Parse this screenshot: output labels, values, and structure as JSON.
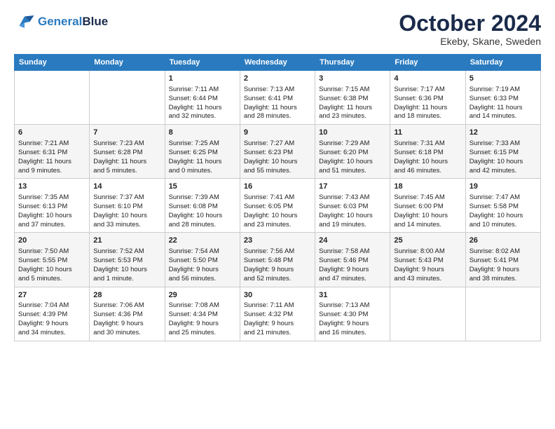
{
  "header": {
    "logo_line1": "General",
    "logo_line2": "Blue",
    "month_title": "October 2024",
    "location": "Ekeby, Skane, Sweden"
  },
  "weekdays": [
    "Sunday",
    "Monday",
    "Tuesday",
    "Wednesday",
    "Thursday",
    "Friday",
    "Saturday"
  ],
  "weeks": [
    [
      {
        "day": "",
        "info": ""
      },
      {
        "day": "",
        "info": ""
      },
      {
        "day": "1",
        "info": "Sunrise: 7:11 AM\nSunset: 6:44 PM\nDaylight: 11 hours\nand 32 minutes."
      },
      {
        "day": "2",
        "info": "Sunrise: 7:13 AM\nSunset: 6:41 PM\nDaylight: 11 hours\nand 28 minutes."
      },
      {
        "day": "3",
        "info": "Sunrise: 7:15 AM\nSunset: 6:38 PM\nDaylight: 11 hours\nand 23 minutes."
      },
      {
        "day": "4",
        "info": "Sunrise: 7:17 AM\nSunset: 6:36 PM\nDaylight: 11 hours\nand 18 minutes."
      },
      {
        "day": "5",
        "info": "Sunrise: 7:19 AM\nSunset: 6:33 PM\nDaylight: 11 hours\nand 14 minutes."
      }
    ],
    [
      {
        "day": "6",
        "info": "Sunrise: 7:21 AM\nSunset: 6:31 PM\nDaylight: 11 hours\nand 9 minutes."
      },
      {
        "day": "7",
        "info": "Sunrise: 7:23 AM\nSunset: 6:28 PM\nDaylight: 11 hours\nand 5 minutes."
      },
      {
        "day": "8",
        "info": "Sunrise: 7:25 AM\nSunset: 6:25 PM\nDaylight: 11 hours\nand 0 minutes."
      },
      {
        "day": "9",
        "info": "Sunrise: 7:27 AM\nSunset: 6:23 PM\nDaylight: 10 hours\nand 55 minutes."
      },
      {
        "day": "10",
        "info": "Sunrise: 7:29 AM\nSunset: 6:20 PM\nDaylight: 10 hours\nand 51 minutes."
      },
      {
        "day": "11",
        "info": "Sunrise: 7:31 AM\nSunset: 6:18 PM\nDaylight: 10 hours\nand 46 minutes."
      },
      {
        "day": "12",
        "info": "Sunrise: 7:33 AM\nSunset: 6:15 PM\nDaylight: 10 hours\nand 42 minutes."
      }
    ],
    [
      {
        "day": "13",
        "info": "Sunrise: 7:35 AM\nSunset: 6:13 PM\nDaylight: 10 hours\nand 37 minutes."
      },
      {
        "day": "14",
        "info": "Sunrise: 7:37 AM\nSunset: 6:10 PM\nDaylight: 10 hours\nand 33 minutes."
      },
      {
        "day": "15",
        "info": "Sunrise: 7:39 AM\nSunset: 6:08 PM\nDaylight: 10 hours\nand 28 minutes."
      },
      {
        "day": "16",
        "info": "Sunrise: 7:41 AM\nSunset: 6:05 PM\nDaylight: 10 hours\nand 23 minutes."
      },
      {
        "day": "17",
        "info": "Sunrise: 7:43 AM\nSunset: 6:03 PM\nDaylight: 10 hours\nand 19 minutes."
      },
      {
        "day": "18",
        "info": "Sunrise: 7:45 AM\nSunset: 6:00 PM\nDaylight: 10 hours\nand 14 minutes."
      },
      {
        "day": "19",
        "info": "Sunrise: 7:47 AM\nSunset: 5:58 PM\nDaylight: 10 hours\nand 10 minutes."
      }
    ],
    [
      {
        "day": "20",
        "info": "Sunrise: 7:50 AM\nSunset: 5:55 PM\nDaylight: 10 hours\nand 5 minutes."
      },
      {
        "day": "21",
        "info": "Sunrise: 7:52 AM\nSunset: 5:53 PM\nDaylight: 10 hours\nand 1 minute."
      },
      {
        "day": "22",
        "info": "Sunrise: 7:54 AM\nSunset: 5:50 PM\nDaylight: 9 hours\nand 56 minutes."
      },
      {
        "day": "23",
        "info": "Sunrise: 7:56 AM\nSunset: 5:48 PM\nDaylight: 9 hours\nand 52 minutes."
      },
      {
        "day": "24",
        "info": "Sunrise: 7:58 AM\nSunset: 5:46 PM\nDaylight: 9 hours\nand 47 minutes."
      },
      {
        "day": "25",
        "info": "Sunrise: 8:00 AM\nSunset: 5:43 PM\nDaylight: 9 hours\nand 43 minutes."
      },
      {
        "day": "26",
        "info": "Sunrise: 8:02 AM\nSunset: 5:41 PM\nDaylight: 9 hours\nand 38 minutes."
      }
    ],
    [
      {
        "day": "27",
        "info": "Sunrise: 7:04 AM\nSunset: 4:39 PM\nDaylight: 9 hours\nand 34 minutes."
      },
      {
        "day": "28",
        "info": "Sunrise: 7:06 AM\nSunset: 4:36 PM\nDaylight: 9 hours\nand 30 minutes."
      },
      {
        "day": "29",
        "info": "Sunrise: 7:08 AM\nSunset: 4:34 PM\nDaylight: 9 hours\nand 25 minutes."
      },
      {
        "day": "30",
        "info": "Sunrise: 7:11 AM\nSunset: 4:32 PM\nDaylight: 9 hours\nand 21 minutes."
      },
      {
        "day": "31",
        "info": "Sunrise: 7:13 AM\nSunset: 4:30 PM\nDaylight: 9 hours\nand 16 minutes."
      },
      {
        "day": "",
        "info": ""
      },
      {
        "day": "",
        "info": ""
      }
    ]
  ]
}
